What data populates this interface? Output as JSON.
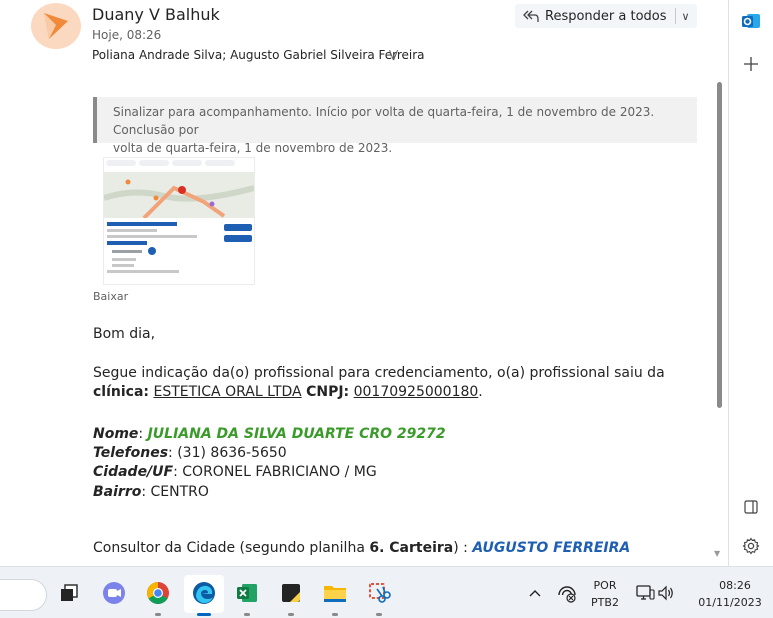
{
  "email": {
    "sender": "Duany V Balhuk",
    "date": "Hoje, 08:26",
    "recipients": "Poliana Andrade Silva; Augusto Gabriel Silveira Ferreira",
    "reply_all_label": "Responder a todos",
    "flag_notice_line1": "Sinalizar para acompanhamento. Início por volta de quarta-feira, 1 de novembro de 2023. Conclusão por",
    "flag_notice_line2": "volta de quarta-feira, 1 de novembro de 2023.",
    "download_label": "Baixar",
    "greeting": "Bom dia,",
    "intro_line1": "Segue indicação da(o) profissional para credenciamento, o(a) profissional saiu da",
    "clinic_label": "clínica:",
    "clinic_name": "ESTETICA ORAL LTDA",
    "cnpj_label": "CNPJ:",
    "cnpj_value": "00170925000180",
    "period": ".",
    "nome_label": "Nome",
    "nome_value": "JULIANA DA SILVA DUARTE CRO 29272",
    "telefones_label": "Telefones",
    "telefones_value": "(31) 8636-5650",
    "cidade_label": "Cidade/UF",
    "cidade_value": "CORONEL FABRICIANO / MG",
    "bairro_label": "Bairro",
    "bairro_value": "CENTRO",
    "consultor_prefix": "Consultor da Cidade (segundo planilha ",
    "consultor_sheet": "6. Carteira",
    "consultor_suffix": ") : ",
    "consultor_name": "AUGUSTO FERREIRA"
  },
  "taskbar": {
    "language_top": "POR",
    "language_bottom": "PTB2",
    "time": "08:26",
    "date": "01/11/2023"
  },
  "colors": {
    "green_value": "#3a9a2a",
    "blue_value": "#1e5fb3",
    "outlook_blue": "#0f6cbd",
    "taskbar_bg": "#eef1f6"
  },
  "icons": [
    "avatar-logo",
    "reply-all-icon",
    "outlook-icon",
    "add-icon",
    "split-view-icon",
    "settings-icon",
    "task-view-icon",
    "teams-icon",
    "chrome-icon",
    "edge-icon",
    "excel-icon",
    "sticky-notes-icon",
    "file-explorer-icon",
    "snipping-tool-icon",
    "chevron-up-icon",
    "network-icon",
    "display-icon",
    "volume-icon"
  ]
}
